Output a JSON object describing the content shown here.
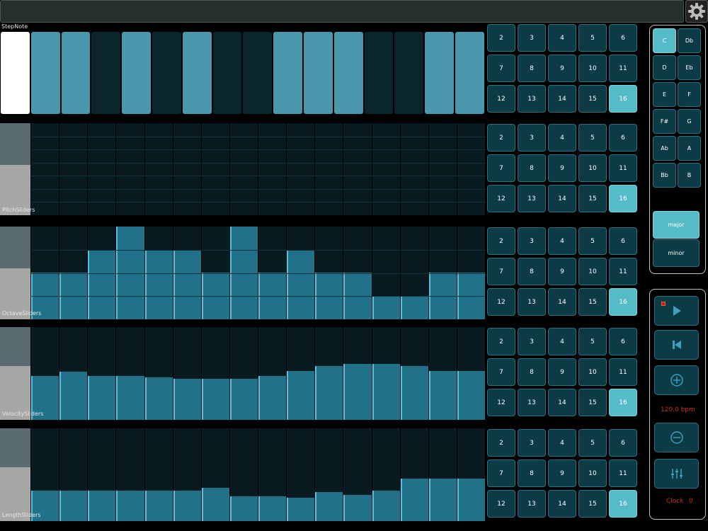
{
  "app": {
    "icons": {
      "settings": "gear-icon",
      "play": "play-icon",
      "rewind": "skip-back-icon",
      "tempo_up": "plus-circle-icon",
      "tempo_down": "minus-circle-icon",
      "mixer": "sliders-icon"
    }
  },
  "colors": {
    "accent": "#55bcc7",
    "slider_fill": "#22718b",
    "slider_edge": "#4cc6df",
    "panel_bg": "#0c3a45",
    "alert": "#cc3322"
  },
  "step_note": {
    "label": "StepNote",
    "steps": [
      "white",
      "on",
      "on",
      "off",
      "on",
      "off",
      "on",
      "off",
      "off",
      "on",
      "on",
      "on",
      "off",
      "off",
      "on",
      "on"
    ]
  },
  "pitch_sliders": {
    "label": "PitchSliders",
    "values": [
      0,
      0,
      0,
      0,
      0,
      0,
      0,
      0,
      0,
      0,
      0,
      0,
      0,
      0,
      0,
      0
    ]
  },
  "octave_sliders": {
    "label": "OctaveSliders",
    "values": [
      0.5,
      0.5,
      0.75,
      1,
      0.75,
      0.75,
      0.5,
      1,
      0.5,
      0.75,
      0.5,
      0.5,
      0.25,
      0.25,
      0.5,
      0.5
    ]
  },
  "velocity_sliders": {
    "label": "VelocitySliders",
    "values": [
      0.47,
      0.52,
      0.47,
      0.47,
      0.46,
      0.44,
      0.44,
      0.44,
      0.47,
      0.53,
      0.58,
      0.6,
      0.6,
      0.58,
      0.53,
      0.53
    ]
  },
  "length_sliders": {
    "label": "LengthSliders",
    "values": [
      0.33,
      0.33,
      0.33,
      0.33,
      0.33,
      0.33,
      0.36,
      0.27,
      0.27,
      0.25,
      0.31,
      0.28,
      0.33,
      0.46,
      0.46,
      0.46
    ]
  },
  "step_count": {
    "labels": [
      "2",
      "3",
      "4",
      "5",
      "6",
      "7",
      "8",
      "9",
      "10",
      "11",
      "12",
      "13",
      "14",
      "15",
      "16"
    ],
    "selected": "16"
  },
  "keys": {
    "notes": [
      "C",
      "Db",
      "D",
      "Eb",
      "E",
      "F",
      "F#",
      "G",
      "Ab",
      "A",
      "Bb",
      "B"
    ],
    "selected": "C",
    "modes": [
      "major",
      "minor"
    ],
    "selected_mode": "major"
  },
  "transport": {
    "tempo": "120.0 bpm",
    "clock_label": "Clock",
    "clock_value": "0"
  }
}
